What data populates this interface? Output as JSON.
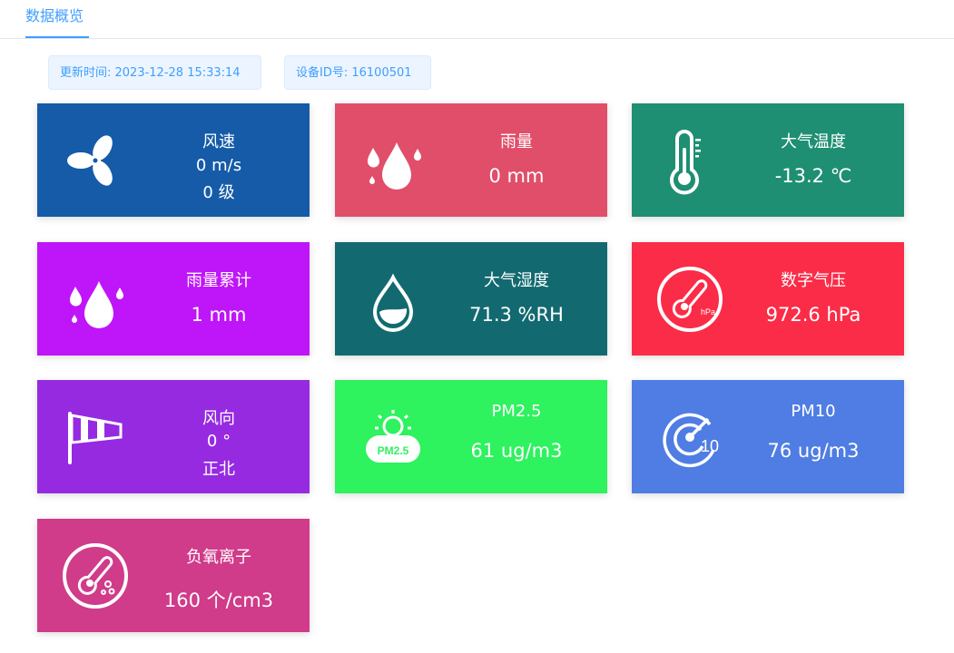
{
  "tab": {
    "label": "数据概览"
  },
  "info": {
    "update_time": "更新时间: 2023-12-28 15:33:14",
    "device_id": "设备ID号: 16100501"
  },
  "cards": {
    "wind_speed": {
      "title": "风速",
      "value": "0 m/s",
      "level": "0 级",
      "color": "#155ba8",
      "icon": "fan-icon"
    },
    "rainfall": {
      "title": "雨量",
      "value": "0 mm",
      "color": "#e14e6a",
      "icon": "raindrops-icon"
    },
    "air_temp": {
      "title": "大气温度",
      "value": "-13.2 ℃",
      "color": "#1e8f72",
      "icon": "thermometer-icon"
    },
    "rain_total": {
      "title": "雨量累计",
      "value": "1 mm",
      "color": "#bf15f9",
      "icon": "raindrops-icon"
    },
    "air_humidity": {
      "title": "大气湿度",
      "value": "71.3 %RH",
      "color": "#126a70",
      "icon": "water-drop-icon"
    },
    "pressure": {
      "title": "数字气压",
      "value": "972.6 hPa",
      "color": "#fb2c47",
      "icon": "pressure-gauge-icon",
      "icon_label": "hPa"
    },
    "wind_dir": {
      "title": "风向",
      "value": "0 °",
      "direction": "正北",
      "color": "#962ae1",
      "icon": "windsock-icon"
    },
    "pm25": {
      "title": "PM2.5",
      "value": "61 ug/m3",
      "color": "#2ef25e",
      "icon": "pm25-cloud-icon",
      "icon_label": "PM2.5"
    },
    "pm10": {
      "title": "PM10",
      "value": "76 ug/m3",
      "color": "#4f7de3",
      "icon": "pm10-radar-icon",
      "icon_label": "10"
    },
    "anion": {
      "title": "负氧离子",
      "value": "160 个/cm3",
      "color": "#d03b8a",
      "icon": "anion-thermometer-icon"
    }
  }
}
